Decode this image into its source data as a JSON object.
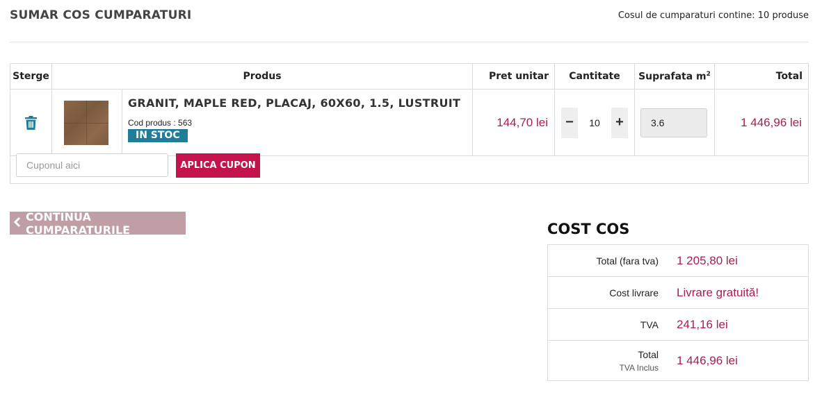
{
  "header": {
    "title": "SUMAR COS CUMPARATURI",
    "cart_count_text": "Cosul de cumparaturi contine: 10 produse"
  },
  "table": {
    "headers": {
      "sterge": "Sterge",
      "produs": "Produs",
      "pret": "Pret unitar",
      "cantitate": "Cantitate",
      "suprafata": "Suprafata m",
      "suprafata_sup": "2",
      "total": "Total"
    },
    "item": {
      "name": "GRANIT, MAPLE RED, PLACAJ, 60X60, 1.5, LUSTRUIT",
      "code": "Cod produs : 563",
      "stock": "IN STOC",
      "price": "144,70 lei",
      "quantity": "10",
      "surface": "3.6",
      "total": "1 446,96 lei",
      "qty_minus": "−",
      "qty_plus": "+"
    }
  },
  "coupon": {
    "placeholder": "Cuponul aici",
    "button": "APLICA CUPON"
  },
  "continue_button": "CONTINUA CUMPARATURILE",
  "cost": {
    "title": "COST COS",
    "rows": [
      {
        "label": "Total (fara tva)",
        "value": "1 205,80 lei"
      },
      {
        "label": "Cost livrare",
        "value": "Livrare gratuită!"
      },
      {
        "label": "TVA",
        "value": "241,16 lei"
      },
      {
        "label": "Total",
        "sublabel": "TVA Inclus",
        "value": "1 446,96 lei"
      }
    ]
  },
  "colors": {
    "accent": "#c4124b",
    "price": "#a8204b",
    "stock_badge": "#1f7d97",
    "trash_icon": "#1f7d97",
    "continue_bg": "#bf9ea4"
  },
  "icons": {
    "delete": "trash-icon",
    "back": "chevron-left-icon"
  }
}
